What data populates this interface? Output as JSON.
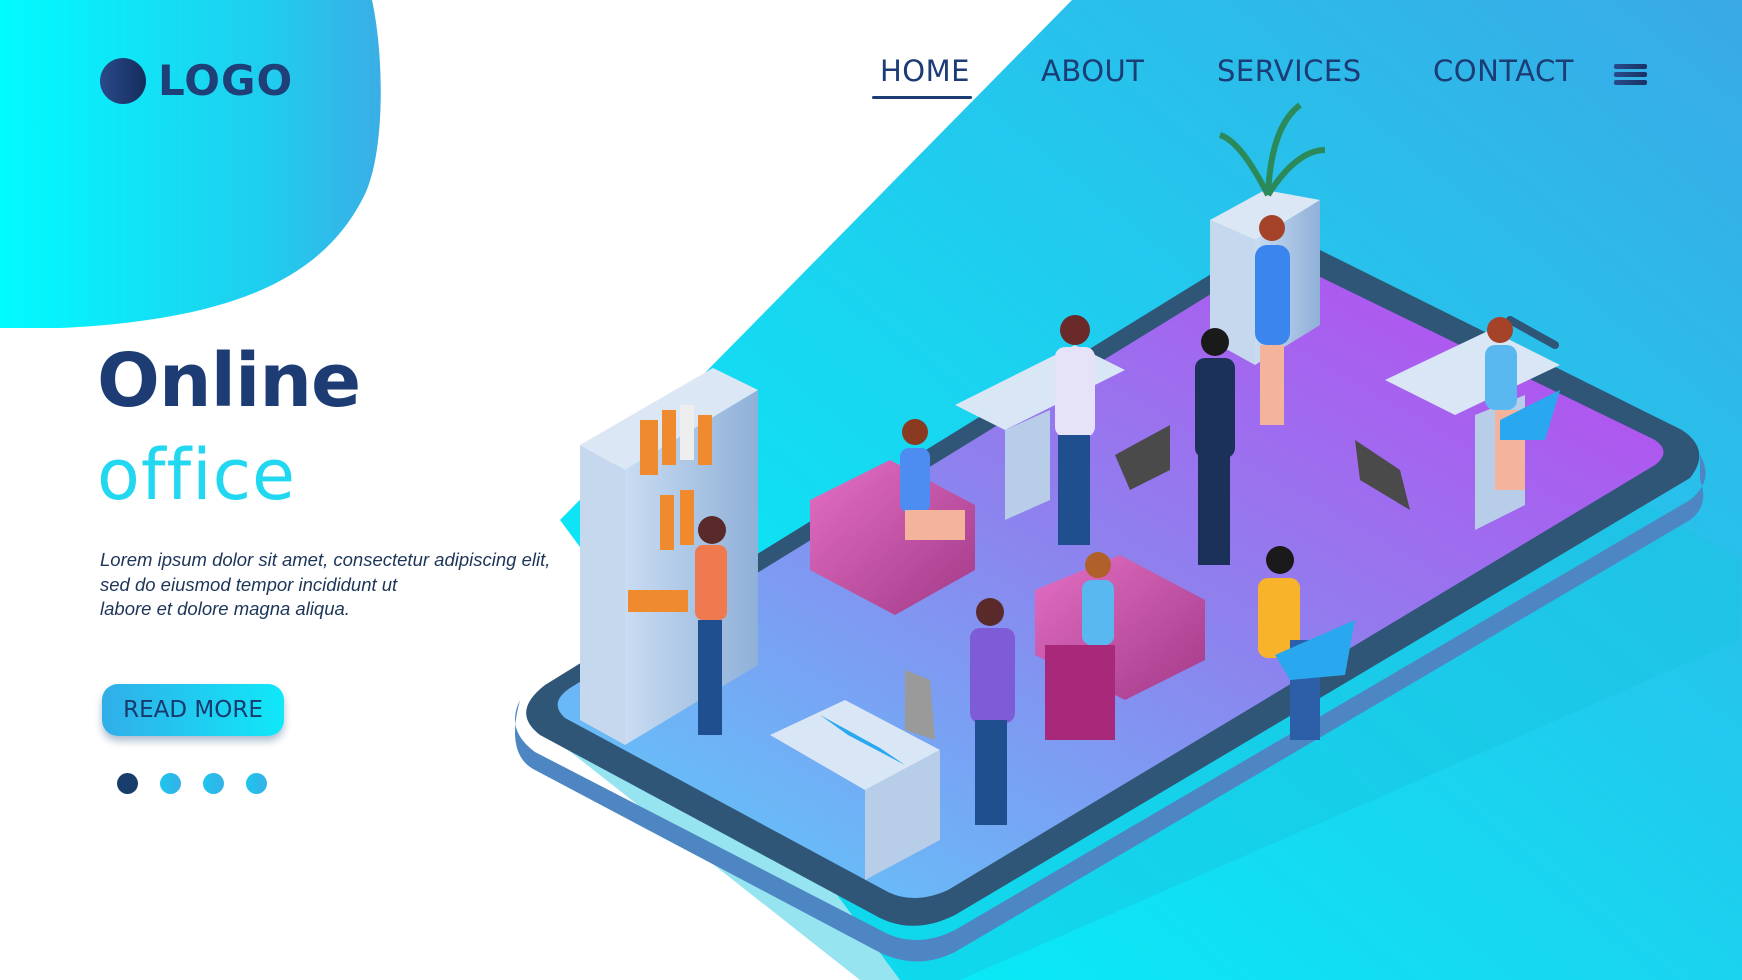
{
  "brand": {
    "logo_text": "LOGO"
  },
  "nav": {
    "items": [
      {
        "label": "HOME",
        "active": true
      },
      {
        "label": "ABOUT",
        "active": false
      },
      {
        "label": "SERVICES",
        "active": false
      },
      {
        "label": "CONTACT",
        "active": false
      }
    ],
    "menu_icon": "hamburger-menu-icon"
  },
  "hero": {
    "title": "Online",
    "subtitle": "office",
    "description": [
      "Lorem ipsum dolor sit amet, consectetur adipiscing elit,",
      "sed do eiusmod tempor incididunt ut",
      "labore et dolore magna aliqua."
    ],
    "cta_label": "READ MORE"
  },
  "carousel": {
    "total": 4,
    "active_index": 0
  },
  "colors": {
    "primary_dark": "#1d3c74",
    "accent_cyan": "#22d7f0",
    "bg_cyan": "#0ff0f8",
    "bg_blue": "#35a8e6",
    "phone_screen_purple": "#b24ff0",
    "phone_frame": "#2f5577"
  }
}
